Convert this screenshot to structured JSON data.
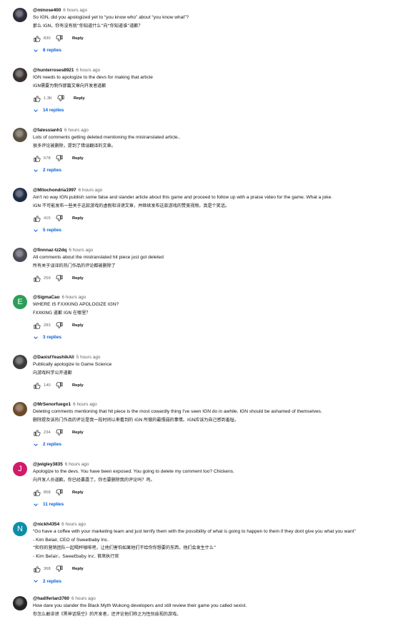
{
  "reply_label": "Reply",
  "comments": [
    {
      "handle": "@minose400",
      "time": "6 hours ago",
      "lines": [
        "So IGN, did you apologized yet to “you know who” about “you know what”?"
      ],
      "zh": [
        "那么 IGN，你有没有就“你知道什么”向“你知道谁”道歉？"
      ],
      "likes": "830",
      "replies": "8 replies",
      "avatar": {
        "type": "img",
        "color": "#2b2b3a"
      }
    },
    {
      "handle": "@hunterroses8921",
      "time": "6 hours ago",
      "lines": [
        "IGN needs to apologize to the devs for making that article"
      ],
      "zh": [
        "IGN需要为制作那篇文章向开发者道歉"
      ],
      "likes": "1.3K",
      "replies": "14 replies",
      "avatar": {
        "type": "img",
        "color": "#3a2f2f"
      }
    },
    {
      "handle": "@falessianh1",
      "time": "6 hours ago",
      "lines": [
        "Lots of comments getting deleted mentioning the mistranslated article.."
      ],
      "zh": [
        "很多评论被删除，提到了错误翻译的文章。"
      ],
      "likes": "578",
      "replies": "2 replies",
      "avatar": {
        "type": "img",
        "color": "#5a5040"
      }
    },
    {
      "handle": "@Mitochondria1997",
      "time": "6 hours ago",
      "lines": [
        "Ain't no way IGN publish some false and slander article about this game and proceed to follow up with a praise video for the game. What a joke."
      ],
      "zh": [
        "IGN 不可能发布一些关于这款游戏的虚假和诽谤文章，并继续发布这款游戏的赞美视频。真是个笑话。"
      ],
      "likes": "415",
      "replies": "5 replies",
      "avatar": {
        "type": "img",
        "color": "#1f2a44"
      }
    },
    {
      "handle": "@finnnaz-tz2dq",
      "time": "6 hours ago",
      "lines": [
        "All comments about the mistranslated hit piece just got deleted"
      ],
      "zh": [
        "所有关于误译的热门作品的评论都被删除了"
      ],
      "likes": "259",
      "replies": "",
      "avatar": {
        "type": "img",
        "color": "#4a4a55"
      }
    },
    {
      "handle": "@SigmaCao",
      "time": "6 hours ago",
      "lines": [
        "WHERE IS FXXKING APOLOGIZE IGN?"
      ],
      "zh": [
        "FXXKING 道歉 IGN 在哪里？"
      ],
      "likes": "283",
      "replies": "3 replies",
      "avatar": {
        "type": "letter",
        "letter": "E",
        "color": "#2e9d59"
      }
    },
    {
      "handle": "@DaoistYeashikAli",
      "time": "5 hours ago",
      "lines": [
        "Publically apologize to Game Science"
      ],
      "zh": [
        "向游戏科学公开道歉"
      ],
      "likes": "140",
      "replies": "",
      "avatar": {
        "type": "img",
        "color": "#3b3b3b"
      }
    },
    {
      "handle": "@MrSenorfuego1",
      "time": "6 hours ago",
      "lines": [
        "Deleting comments mentioning that hit piece is the most cowardly thing I've seen IGN do in awhile. IGN should be ashamed of themselves."
      ],
      "zh": [
        "删除提及该热门作品的评论是我一段时间以来看到的 IGN 所做的最懦弱的事情。IGN应该为自己感到羞耻。"
      ],
      "likes": "234",
      "replies": "2 replies",
      "avatar": {
        "type": "img",
        "color": "#6b4a2a"
      }
    },
    {
      "handle": "@jwigley3835",
      "time": "6 hours ago",
      "lines": [
        "Apologize to the devs. You have been exposed. You going to delete my comment too? Chickens."
      ],
      "zh": [
        "向开发人员道歉。你已经暴露了。你也要删除我的评论吗？鸡。"
      ],
      "likes": "858",
      "replies": "11 replies",
      "avatar": {
        "type": "letter",
        "letter": "J",
        "color": "#d21a6b"
      }
    },
    {
      "handle": "@nickh4354",
      "time": "6 hours ago",
      "lines": [
        "“Go have a coffee with your marketing team and just terrify them with the possibility of what is going to happen to them if they dont give you what you want”",
        "- Kim Belair, CEO of Sweetbaby Inc."
      ],
      "zh": [
        "“和你的营销团队一起喝杯咖啡吧，让他们害怕如果他们不给你你想要的东西，他们会发生什么”",
        "- Kim Belair，Sweetbaby Inc. 首席执行官"
      ],
      "likes": "368",
      "replies": "2 replies",
      "avatar": {
        "type": "letter",
        "letter": "N",
        "color": "#0d8ea8"
      }
    },
    {
      "handle": "@hadiferlan3760",
      "time": "6 hours ago",
      "lines": [
        "How dare you slander the Black Myth Wukong developers and still review their game you called sexist."
      ],
      "zh": [
        "你怎么敢诽谤《黑神话悟空》的开发者，还评论他们称之为性别歧视的游戏。"
      ],
      "likes": "",
      "replies": "",
      "avatar": {
        "type": "img",
        "color": "#222222"
      }
    }
  ]
}
